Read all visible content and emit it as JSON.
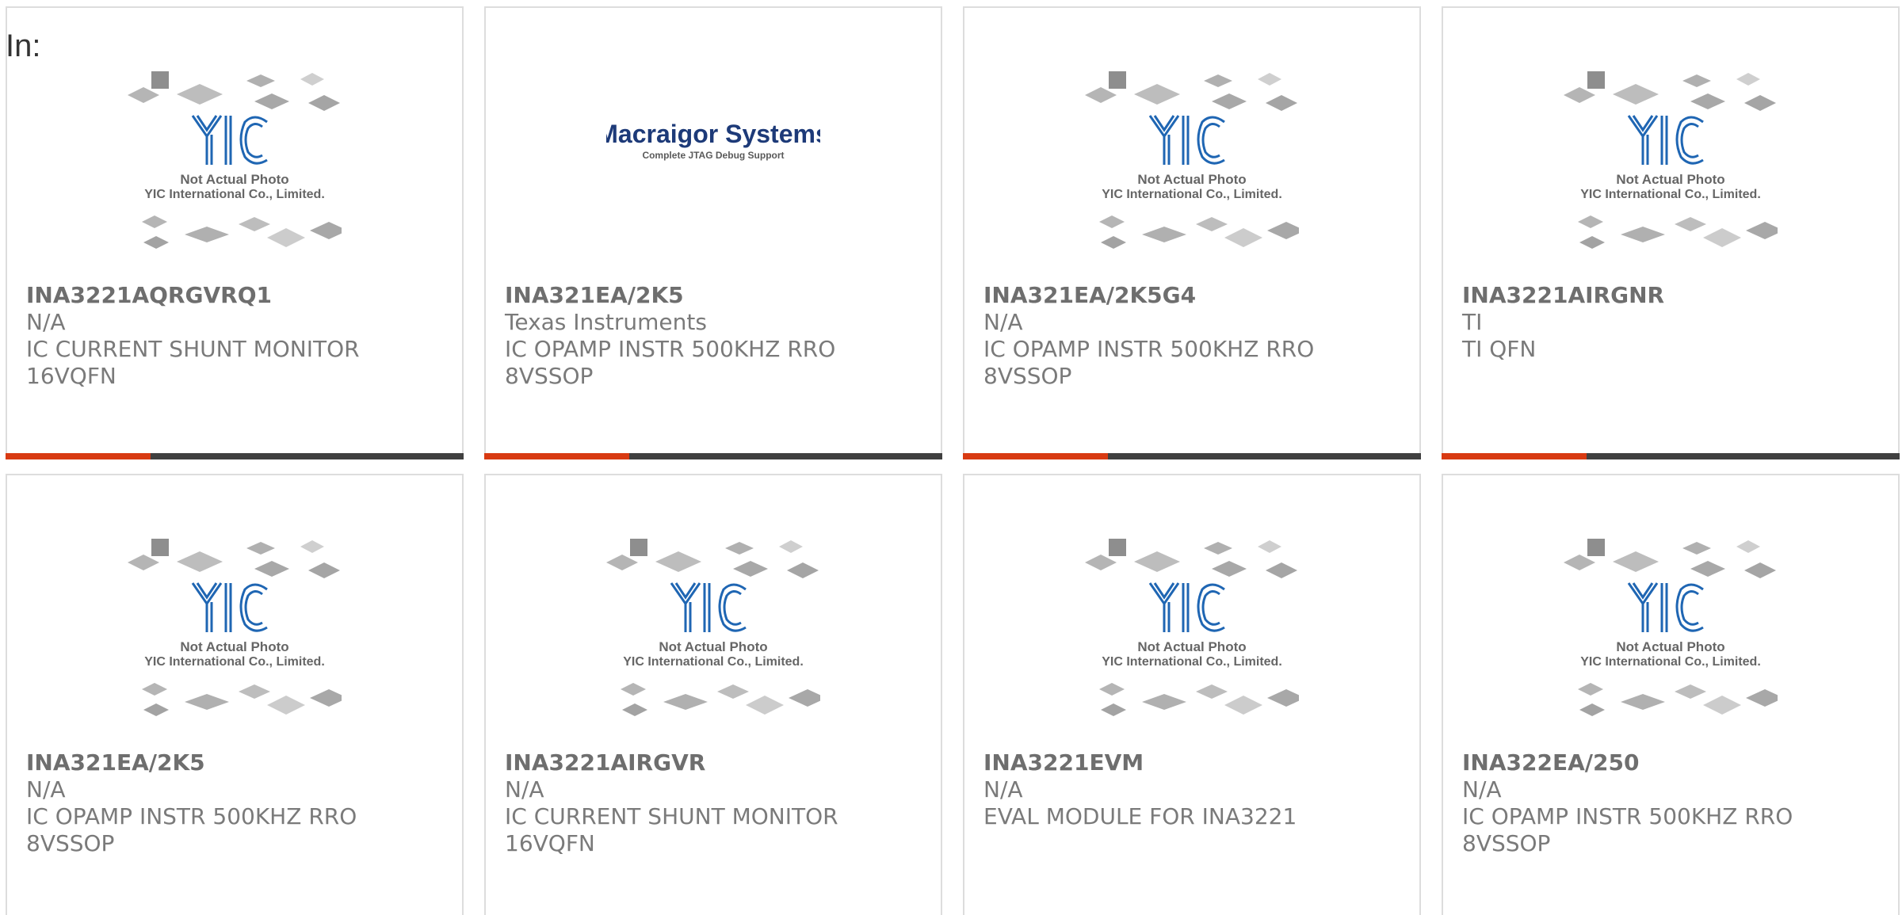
{
  "heading": "In:",
  "colors": {
    "accent": "#d83a12",
    "bar": "#404040",
    "border": "#dddddd",
    "text": "#7a7a7a",
    "logo_blue": "#1f66b3",
    "brand_navy": "#1d3a78"
  },
  "placeholder_image": {
    "line1": "Not Actual Photo",
    "line2": "YIC International Co., Limited.",
    "logo": "YIC"
  },
  "brand_image": {
    "line1": "Macraigor Systems",
    "line2": "Complete JTAG Debug Support"
  },
  "products": [
    {
      "part": "INA3221AQRGVRQ1",
      "maker": "N/A",
      "desc1": "IC CURRENT SHUNT MONITOR",
      "desc2": "16VQFN",
      "image": "placeholder-image"
    },
    {
      "part": "INA321EA/2K5",
      "maker": "Texas Instruments",
      "desc1": "IC OPAMP INSTR 500KHZ RRO",
      "desc2": "8VSSOP",
      "image": "macraigor-logo"
    },
    {
      "part": "INA321EA/2K5G4",
      "maker": "N/A",
      "desc1": "IC OPAMP INSTR 500KHZ RRO",
      "desc2": "8VSSOP",
      "image": "placeholder-image"
    },
    {
      "part": "INA3221AIRGNR",
      "maker": "TI",
      "desc1": "TI QFN",
      "desc2": "",
      "image": "placeholder-image"
    },
    {
      "part": "INA321EA/2K5",
      "maker": "N/A",
      "desc1": "IC OPAMP INSTR 500KHZ RRO",
      "desc2": "8VSSOP",
      "image": "placeholder-image"
    },
    {
      "part": "INA3221AIRGVR",
      "maker": "N/A",
      "desc1": "IC CURRENT SHUNT MONITOR",
      "desc2": "16VQFN",
      "image": "placeholder-image"
    },
    {
      "part": "INA3221EVM",
      "maker": "N/A",
      "desc1": "EVAL MODULE FOR INA3221",
      "desc2": "",
      "image": "placeholder-image"
    },
    {
      "part": "INA322EA/250",
      "maker": "N/A",
      "desc1": "IC OPAMP INSTR 500KHZ RRO",
      "desc2": "8VSSOP",
      "image": "placeholder-image"
    }
  ]
}
